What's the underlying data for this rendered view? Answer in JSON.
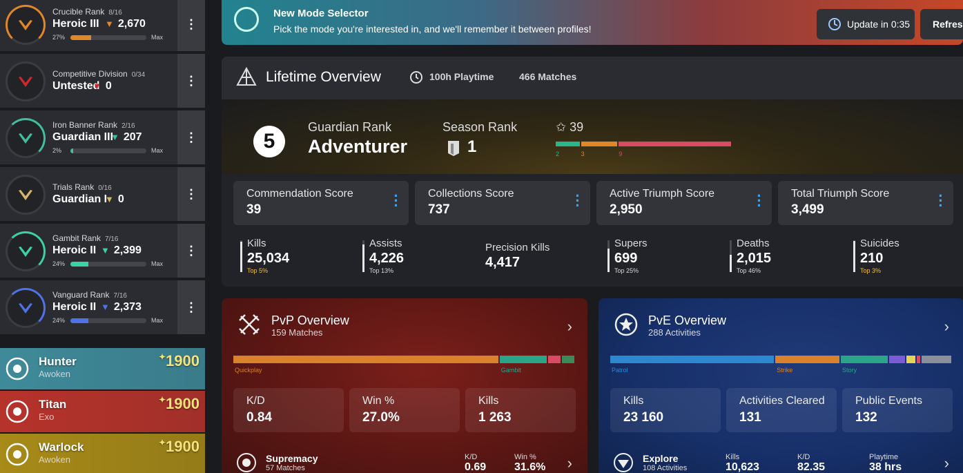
{
  "ranks": [
    {
      "name": "Crucible Rank",
      "count": "8/16",
      "value": "Heroic III",
      "points": "2,670",
      "pct": "27%",
      "max": "Max",
      "color": "#e0872a",
      "fill": 0.27,
      "icon_color": "#e0872a"
    },
    {
      "name": "Competitive Division",
      "count": "0/34",
      "value": "Untested",
      "points": "0",
      "pct": "",
      "max": "",
      "color": "#c0282d",
      "fill": 0,
      "icon_color": "#d0262c"
    },
    {
      "name": "Iron Banner Rank",
      "count": "2/16",
      "value": "Guardian III",
      "points": "207",
      "pct": "2%",
      "max": "Max",
      "color": "#3fbfa0",
      "fill": 0.02,
      "icon_color": "#3fbfa0"
    },
    {
      "name": "Trials Rank",
      "count": "0/16",
      "value": "Guardian I",
      "points": "0",
      "pct": "",
      "max": "",
      "color": "#d6b66a",
      "fill": 0,
      "icon_color": "#d6b66a"
    },
    {
      "name": "Gambit Rank",
      "count": "7/16",
      "value": "Heroic II",
      "points": "2,399",
      "pct": "24%",
      "max": "Max",
      "color": "#3bd3a3",
      "fill": 0.24,
      "icon_color": "#3bd3a3"
    },
    {
      "name": "Vanguard Rank",
      "count": "7/16",
      "value": "Heroic II",
      "points": "2,373",
      "pct": "24%",
      "max": "Max",
      "color": "#4f73e6",
      "fill": 0.24,
      "icon_color": "#4f73e6"
    }
  ],
  "characters": [
    {
      "class": "Hunter",
      "race": "Awoken",
      "light": "1900",
      "bg": "#3f8a9a"
    },
    {
      "class": "Titan",
      "race": "Exo",
      "light": "1900",
      "bg": "#b6332b"
    },
    {
      "class": "Warlock",
      "race": "Awoken",
      "light": "1900",
      "bg": "#a78a18"
    }
  ],
  "banner": {
    "title": "New Mode Selector",
    "subtitle": "Pick the mode you're interested in, and we'll remember it between profiles!",
    "update": "Update in 0:35",
    "refresh": "Refresh"
  },
  "lifetime": {
    "title": "Lifetime Overview",
    "playtime": "100h Playtime",
    "matches": "466 Matches",
    "guardian_rank_label": "Guardian Rank",
    "guardian_rank_num": "5",
    "guardian_rank_value": "Adventurer",
    "season_rank_label": "Season Rank",
    "season_rank_value": "1",
    "stars": "39",
    "segments": [
      {
        "label": "2",
        "value": 2,
        "color": "#2bb58b"
      },
      {
        "label": "3",
        "value": 3,
        "color": "#e0872a"
      },
      {
        "label": "9",
        "value": 9,
        "color": "#d94a65"
      }
    ],
    "scores": [
      {
        "label": "Commendation Score",
        "value": "39"
      },
      {
        "label": "Collections Score",
        "value": "737"
      },
      {
        "label": "Active Triumph Score",
        "value": "2,950"
      },
      {
        "label": "Total Triumph Score",
        "value": "3,499"
      }
    ],
    "stats": [
      {
        "label": "Kills",
        "value": "25,034",
        "top": "Top 5%",
        "top_color": "#f0c23a",
        "fill": 0.95
      },
      {
        "label": "Assists",
        "value": "4,226",
        "top": "Top 13%",
        "top_color": "#d9d9d9",
        "fill": 0.87
      },
      {
        "label": "Precision Kills",
        "value": "4,417",
        "top": "",
        "top_color": "#d9d9d9",
        "fill": 0
      },
      {
        "label": "Supers",
        "value": "699",
        "top": "Top 25%",
        "top_color": "#d9d9d9",
        "fill": 0.75
      },
      {
        "label": "Deaths",
        "value": "2,015",
        "top": "Top 46%",
        "top_color": "#d9d9d9",
        "fill": 0.54
      },
      {
        "label": "Suicides",
        "value": "210",
        "top": "Top 3%",
        "top_color": "#f0c23a",
        "fill": 0.97
      }
    ]
  },
  "pvp": {
    "title": "PvP Overview",
    "subtitle": "159 Matches",
    "segments": [
      {
        "label": "Quickplay",
        "value": 77,
        "color": "#d9822b"
      },
      {
        "label": "Gambit",
        "value": 14,
        "color": "#2aa58a"
      },
      {
        "label": "",
        "value": 4,
        "color": "#d94a65"
      },
      {
        "label": "",
        "value": 4,
        "color": "#3a8a5a"
      }
    ],
    "cards": [
      {
        "label": "K/D",
        "value": "0.84"
      },
      {
        "label": "Win %",
        "value": "27.0%"
      },
      {
        "label": "Kills",
        "value": "1 263"
      }
    ],
    "sub": {
      "name": "Supremacy",
      "count": "57 Matches",
      "h1": "K/D",
      "v1": "0.69",
      "h2": "Win %",
      "v2": "31.6%"
    }
  },
  "pve": {
    "title": "PvE Overview",
    "subtitle": "288 Activities",
    "segments": [
      {
        "label": "Patrol",
        "value": 48,
        "color": "#2e88d0"
      },
      {
        "label": "Strike",
        "value": 19,
        "color": "#d9822b"
      },
      {
        "label": "Story",
        "value": 14,
        "color": "#2aa58a"
      },
      {
        "label": "",
        "value": 5,
        "color": "#7b5bd6"
      },
      {
        "label": "",
        "value": 3,
        "color": "#e6d555"
      },
      {
        "label": "",
        "value": 1.5,
        "color": "#d94a65"
      },
      {
        "label": "",
        "value": 9,
        "color": "#8a8f99"
      }
    ],
    "cards": [
      {
        "label": "Kills",
        "value": "23 160"
      },
      {
        "label": "Activities Cleared",
        "value": "131"
      },
      {
        "label": "Public Events",
        "value": "132"
      }
    ],
    "sub": {
      "name": "Explore",
      "count": "108 Activities",
      "h1": "Kills",
      "v1": "10,623",
      "h2": "K/D",
      "v2": "82.35",
      "h3": "Playtime",
      "v3": "38 hrs"
    }
  }
}
